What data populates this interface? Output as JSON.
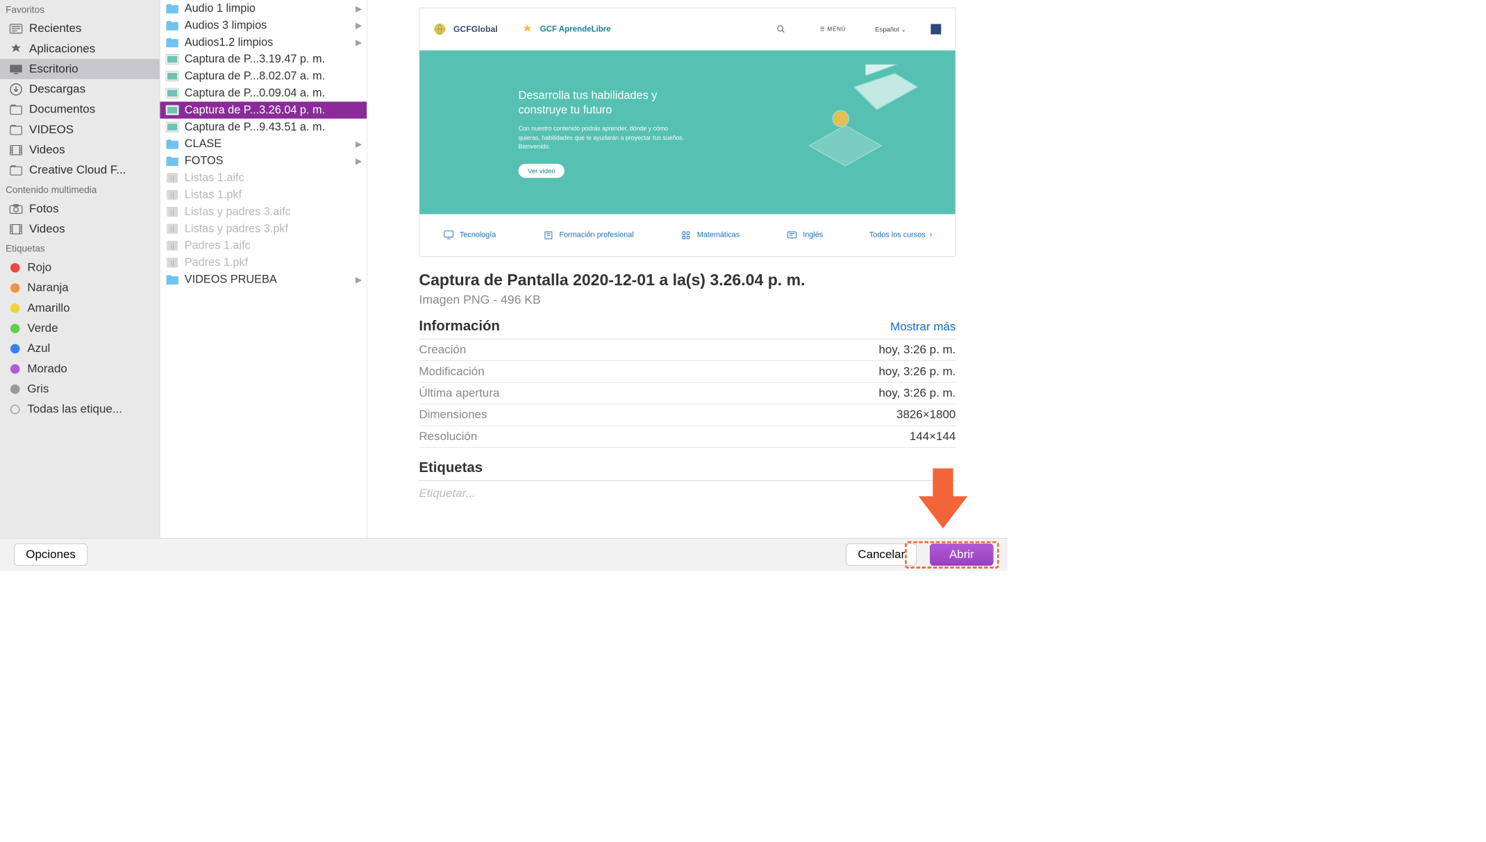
{
  "sidebar": {
    "favorites_label": "Favoritos",
    "items": [
      {
        "label": "Recientes"
      },
      {
        "label": "Aplicaciones"
      },
      {
        "label": "Escritorio"
      },
      {
        "label": "Descargas"
      },
      {
        "label": "Documentos"
      },
      {
        "label": "VIDEOS"
      },
      {
        "label": "Videos"
      },
      {
        "label": "Creative Cloud F..."
      }
    ],
    "media_label": "Contenido multimedia",
    "media_items": [
      {
        "label": "Fotos"
      },
      {
        "label": "Videos"
      }
    ],
    "tags_label": "Etiquetas",
    "tags": [
      {
        "label": "Rojo",
        "color": "#ef4646"
      },
      {
        "label": "Naranja",
        "color": "#f2933a"
      },
      {
        "label": "Amarillo",
        "color": "#f1d33a"
      },
      {
        "label": "Verde",
        "color": "#62cf4b"
      },
      {
        "label": "Azul",
        "color": "#3b7ef3"
      },
      {
        "label": "Morado",
        "color": "#b05bd8"
      },
      {
        "label": "Gris",
        "color": "#9a9a9a"
      }
    ],
    "all_tags": "Todas las etique..."
  },
  "files": [
    {
      "name": "Audio 1 limpio",
      "type": "folder",
      "has_children": true
    },
    {
      "name": "Audios 3 limpios",
      "type": "folder",
      "has_children": true
    },
    {
      "name": "Audios1.2 limpios",
      "type": "folder",
      "has_children": true
    },
    {
      "name": "Captura de P...3.19.47 p. m.",
      "type": "png"
    },
    {
      "name": "Captura de P...8.02.07 a. m.",
      "type": "png"
    },
    {
      "name": "Captura de P...0.09.04 a. m.",
      "type": "png"
    },
    {
      "name": "Captura de P...3.26.04 p. m.",
      "type": "png",
      "selected": true
    },
    {
      "name": "Captura de P...9.43.51 a. m.",
      "type": "png"
    },
    {
      "name": "CLASE",
      "type": "folder",
      "has_children": true
    },
    {
      "name": "FOTOS",
      "type": "folder",
      "has_children": true
    },
    {
      "name": "Listas 1.aifc",
      "type": "audio",
      "dim": true
    },
    {
      "name": "Listas 1.pkf",
      "type": "audio",
      "dim": true
    },
    {
      "name": "Listas y padres 3.aifc",
      "type": "audio",
      "dim": true
    },
    {
      "name": "Listas y padres 3.pkf",
      "type": "audio",
      "dim": true
    },
    {
      "name": "Padres 1.aifc",
      "type": "audio",
      "dim": true
    },
    {
      "name": "Padres 1.pkf",
      "type": "audio",
      "dim": true
    },
    {
      "name": "VIDEOS PRUEBA",
      "type": "folder",
      "has_children": true
    }
  ],
  "preview": {
    "hero_title": "Desarrolla tus habilidades y construye tu futuro",
    "hero_body": "Con nuestro contenido podrás aprender, dónde y cómo quieras, habilidades que te ayudarán a proyectar tus sueños. Bienvenido.",
    "hero_btn": "Ver video",
    "brand1": "GCFGlobal",
    "brand2": "GCF AprendeLibre",
    "menu_label": "MENÚ",
    "lang": "Español",
    "cats": [
      "Tecnología",
      "Formación profesional",
      "Matemáticas",
      "Inglés",
      "Todos los cursos"
    ],
    "title": "Captura de Pantalla 2020-12-01 a la(s) 3.26.04 p. m.",
    "subtitle": "Imagen PNG - 496 KB",
    "info_label": "Información",
    "show_more": "Mostrar más",
    "rows": [
      {
        "k": "Creación",
        "v": "hoy, 3:26 p. m."
      },
      {
        "k": "Modificación",
        "v": "hoy, 3:26 p. m."
      },
      {
        "k": "Última apertura",
        "v": "hoy, 3:26 p. m."
      },
      {
        "k": "Dimensiones",
        "v": "3826×1800"
      },
      {
        "k": "Resolución",
        "v": "144×144"
      }
    ],
    "tags_label": "Etiquetas",
    "tags_placeholder": "Etiquetar..."
  },
  "footer": {
    "options": "Opciones",
    "cancel": "Cancelar",
    "open": "Abrir"
  }
}
